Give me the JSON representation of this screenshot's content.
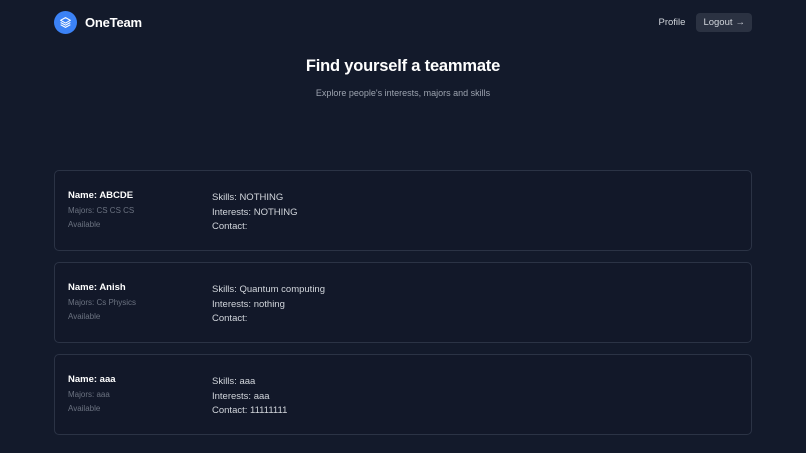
{
  "app": {
    "name": "OneTeam"
  },
  "nav": {
    "profile_label": "Profile",
    "logout_label": "Logout",
    "logout_arrow": "→"
  },
  "hero": {
    "title": "Find yourself a teammate",
    "subtitle": "Explore people's interests, majors and skills"
  },
  "people": [
    {
      "name": "Name: ABCDE",
      "majors": "Majors: CS CS CS",
      "status": "Available",
      "skills": "Skills: NOTHING",
      "interests": "Interests: NOTHING",
      "contact": "Contact:"
    },
    {
      "name": "Name: Anish",
      "majors": "Majors: Cs Physics",
      "status": "Available",
      "skills": "Skills: Quantum computing",
      "interests": "Interests: nothing",
      "contact": "Contact:"
    },
    {
      "name": "Name: aaa",
      "majors": "Majors: aaa",
      "status": "Available",
      "skills": "Skills: aaa",
      "interests": "Interests: aaa",
      "contact": "Contact: 11111111"
    }
  ]
}
